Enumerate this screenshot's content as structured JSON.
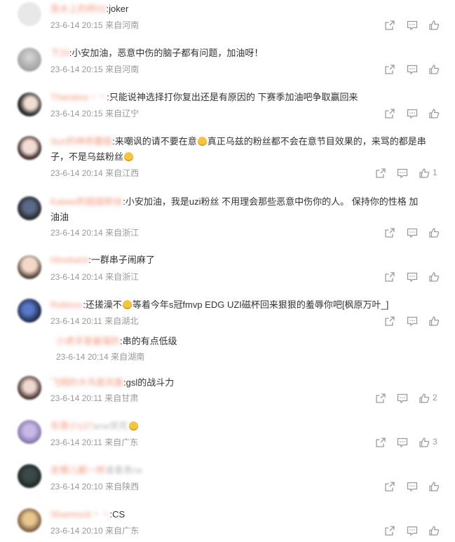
{
  "comments": [
    {
      "user": "恶水上的桥02",
      "text": "joker",
      "date": "23-6-14 20:15",
      "location": "来自河南",
      "likes": ""
    },
    {
      "user": "下Zil",
      "text": "小安加油，恶意中伤的脑子都有问题，加油呀！",
      "date": "23-6-14 20:15",
      "location": "来自河南",
      "likes": ""
    },
    {
      "user": "Thanatos丶丶",
      "text": "只能说神选择打你复出还是有原因的 下赛季加油吧争取赢回来",
      "date": "23-6-14 20:15",
      "location": "来自辽宁",
      "likes": ""
    },
    {
      "user": "Sun的神奇蘑菇",
      "text_a": "来嘲讽的请不要在意",
      "text_b": "真正乌兹的粉丝都不会在意节目效果的，来骂的都是串",
      "text_c": "子，不是乌兹粉丝",
      "date": "23-6-14 20:14",
      "location": "来自江西",
      "likes": "1"
    },
    {
      "user": "Kaiwei的超级粉丝",
      "text_a": "小安加油，我是uzi粉丝 不用理会那些恶意中伤你的人。 保持你的性格 加",
      "text_b": "油油",
      "date": "23-6-14 20:14",
      "location": "来自浙江",
      "likes": ""
    },
    {
      "user": "Hinokami",
      "text": "一群串子闹麻了",
      "date": "23-6-14 20:14",
      "location": "来自浙江",
      "likes": ""
    },
    {
      "user": "Rubixxc",
      "text_a": "还搓澡不",
      "text_b": "等着今年s冠fmvp EDG UZI磁杯回来狠狠的羞辱你吧[枫原万叶_]",
      "date": "23-6-14 20:11",
      "location": "来自湖北",
      "likes": ""
    },
    {
      "user": "小虎牙是最强的",
      "text": "串的有点低级",
      "date": "23-6-14 20:14",
      "location": "来自湖南",
      "likes": ""
    },
    {
      "user": "飞翔的大鸟是凤凰",
      "text": "gsl的战斗力",
      "date": "23-6-14 20:11",
      "location": "来自甘肃",
      "likes": "2"
    },
    {
      "user": "东翠小127",
      "text": "anw笑死",
      "date": "23-6-14 20:11",
      "location": "来自广东",
      "likes": "3"
    },
    {
      "user": "走哪儿都一样",
      "text": "谁看表rw",
      "date": "23-6-14 20:10",
      "location": "来自陕西",
      "likes": ""
    },
    {
      "user": "Shamrock丶丶",
      "text": "CS",
      "date": "23-6-14 20:10",
      "location": "来自广东",
      "likes": ""
    }
  ],
  "colors": {
    "username": "#eb7350",
    "meta": "#999999",
    "icon": "#9a9a9a"
  },
  "icons": {
    "share": "share-icon",
    "comment": "comment-icon",
    "like": "like-icon"
  }
}
